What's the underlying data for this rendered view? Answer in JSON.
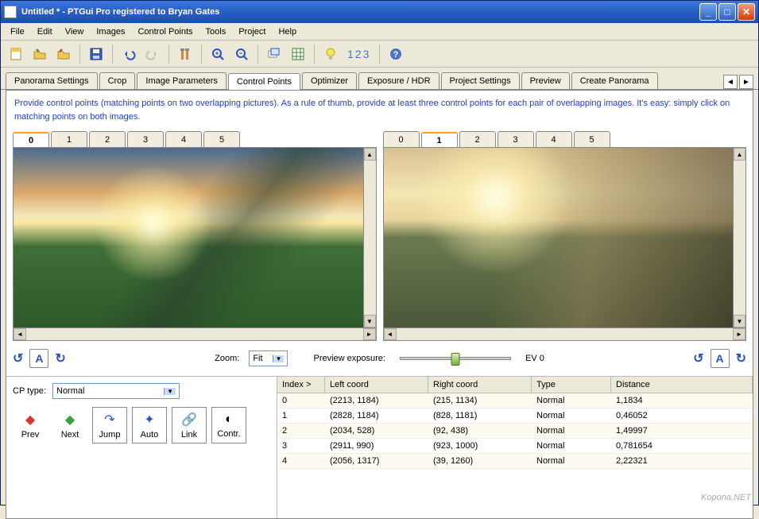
{
  "title": "Untitled * - PTGui Pro registered to Bryan Gates",
  "menu": [
    "File",
    "Edit",
    "View",
    "Images",
    "Control Points",
    "Tools",
    "Project",
    "Help"
  ],
  "toolbar": {
    "numbers": "123"
  },
  "tabs": [
    "Panorama Settings",
    "Crop",
    "Image Parameters",
    "Control Points",
    "Optimizer",
    "Exposure / HDR",
    "Project Settings",
    "Preview",
    "Create Panorama"
  ],
  "tabs_active": 3,
  "hint": "Provide control points (matching points on two overlapping pictures). As a rule of thumb, provide at least three control points for each pair of overlapping images. It's easy: simply click on matching points on both images.",
  "left_tabs": [
    "0",
    "1",
    "2",
    "3",
    "4",
    "5"
  ],
  "left_active": 0,
  "right_tabs": [
    "0",
    "1",
    "2",
    "3",
    "4",
    "5"
  ],
  "right_active": 1,
  "zoom_label": "Zoom:",
  "zoom_value": "Fit",
  "preview_label": "Preview exposure:",
  "ev": "EV 0",
  "cp_label": "CP type:",
  "cp_value": "Normal",
  "nav": {
    "prev": "Prev",
    "next": "Next",
    "jump": "Jump",
    "auto": "Auto",
    "link": "Link",
    "contr": "Contr."
  },
  "cols": [
    "Index >",
    "Left coord",
    "Right coord",
    "Type",
    "Distance"
  ],
  "rows": [
    {
      "i": "0",
      "l": "(2213, 1184)",
      "r": "(215, 1134)",
      "t": "Normal",
      "d": "1,1834"
    },
    {
      "i": "1",
      "l": "(2828, 1184)",
      "r": "(828, 1181)",
      "t": "Normal",
      "d": "0,46052"
    },
    {
      "i": "2",
      "l": "(2034, 528)",
      "r": "(92, 438)",
      "t": "Normal",
      "d": "1,49997"
    },
    {
      "i": "3",
      "l": "(2911, 990)",
      "r": "(923, 1000)",
      "t": "Normal",
      "d": "0,781654"
    },
    {
      "i": "4",
      "l": "(2056, 1317)",
      "r": "(39, 1260)",
      "t": "Normal",
      "d": "2,22321"
    }
  ],
  "watermark": "Kopona.NET"
}
